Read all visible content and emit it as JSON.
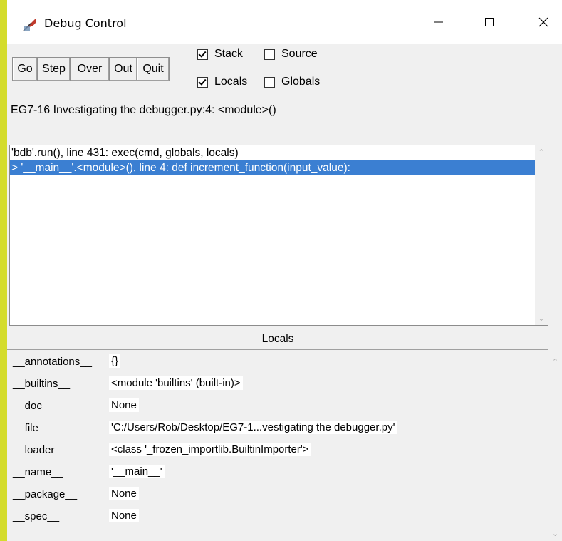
{
  "window": {
    "title": "Debug Control",
    "icons": {
      "app": "feather-debug-icon",
      "minimize": "minimize-icon",
      "maximize": "maximize-icon",
      "close": "close-icon"
    }
  },
  "toolbar": {
    "buttons": [
      "Go",
      "Step",
      "Over",
      "Out",
      "Quit"
    ]
  },
  "options": {
    "stack": {
      "label": "Stack",
      "checked": true
    },
    "source": {
      "label": "Source",
      "checked": false
    },
    "locals": {
      "label": "Locals",
      "checked": true
    },
    "globals": {
      "label": "Globals",
      "checked": false
    }
  },
  "status": "EG7-16 Investigating the debugger.py:4: <module>()",
  "stack": {
    "lines": [
      {
        "text": "'bdb'.run(), line 431: exec(cmd, globals, locals)",
        "selected": false
      },
      {
        "text": "> '__main__'.<module>(), line 4: def increment_function(input_value):",
        "selected": true
      }
    ]
  },
  "locals": {
    "header": "Locals",
    "rows": [
      {
        "name": "__annotations__",
        "value": "{}"
      },
      {
        "name": "__builtins__",
        "value": "<module 'builtins' (built-in)>"
      },
      {
        "name": "__doc__",
        "value": "None"
      },
      {
        "name": "__file__",
        "value": "'C:/Users/Rob/Desktop/EG7-1...vestigating the debugger.py'"
      },
      {
        "name": "__loader__",
        "value": "<class '_frozen_importlib.BuiltinImporter'>"
      },
      {
        "name": "__name__",
        "value": "'__main__'"
      },
      {
        "name": "__package__",
        "value": "None"
      },
      {
        "name": "__spec__",
        "value": "None"
      }
    ]
  },
  "colors": {
    "frame": "#d4dc2c",
    "selection": "#3b7fd2"
  }
}
